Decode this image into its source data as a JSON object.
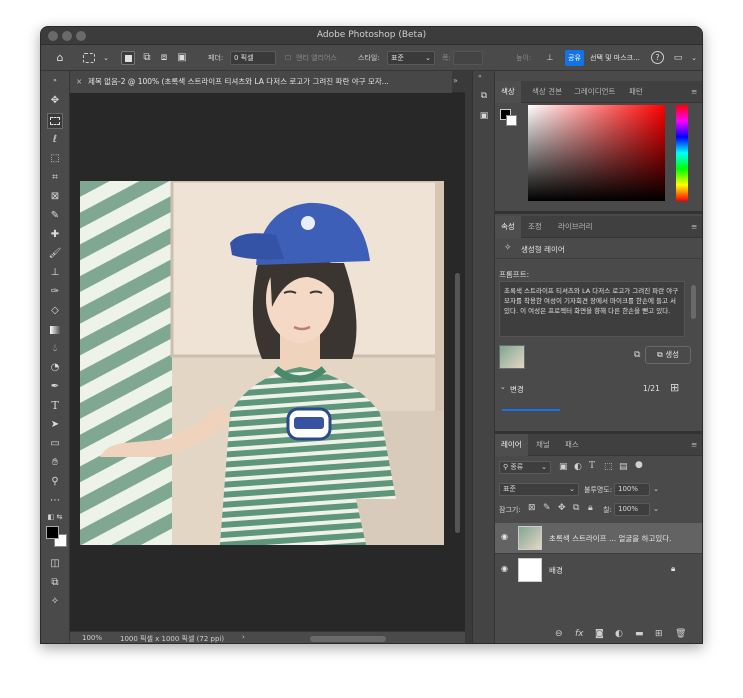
{
  "window": {
    "title": "Adobe Photoshop (Beta)"
  },
  "options": {
    "feather_label": "페더:",
    "feather_value": "0 픽셀",
    "antialias_label": "앤티 앨리어스",
    "style_label": "스타일:",
    "style_value": "표준",
    "width_label": "폭:",
    "height_label": "높이:",
    "share_label": "공유",
    "select_mask_label": "선택 및 마스크..."
  },
  "document": {
    "tab_title": "제목 없음-2 @ 100% (초록색 스트라이프 티셔츠와 LA 다저스 로고가 그려진  파란 야구 모자...",
    "zoom": "100%",
    "info": "1000 픽셀 x 1000 픽셀 (72 ppi)"
  },
  "color_panel": {
    "tabs": [
      "색상",
      "색상 견본",
      "그레이디언트",
      "패턴"
    ]
  },
  "properties_panel": {
    "tabs": [
      "속성",
      "조정",
      "라이브러리"
    ],
    "layer_type": "생성형 레이어",
    "prompt_label": "프롬프트:",
    "prompt_text": "초록색 스트라이프 티셔츠와 LA 다저스 로고가 그려진  파란 야구 모자를 착용한 여성이 기자회견 장에서 마이크를 한손에 들고 서있다. 이 여성은 프로젝터 화면을 향해 다른 한손을 뻗고 있다.",
    "generate_label": "생성",
    "variations_label": "변경",
    "variations_count": "1/21"
  },
  "layers_panel": {
    "tabs": [
      "레이어",
      "채널",
      "패스"
    ],
    "filter_value": "종류",
    "blend_mode": "표준",
    "opacity_label": "불투명도:",
    "opacity_value": "100%",
    "lock_label": "잠그기:",
    "fill_label": "칠:",
    "fill_value": "100%",
    "layers": [
      {
        "name": "초록색 스트라이프 ... 얼굴을 하고있다."
      },
      {
        "name": "배경"
      }
    ]
  },
  "colors": {
    "accent": "#1473e6",
    "share": "#1473e6"
  }
}
